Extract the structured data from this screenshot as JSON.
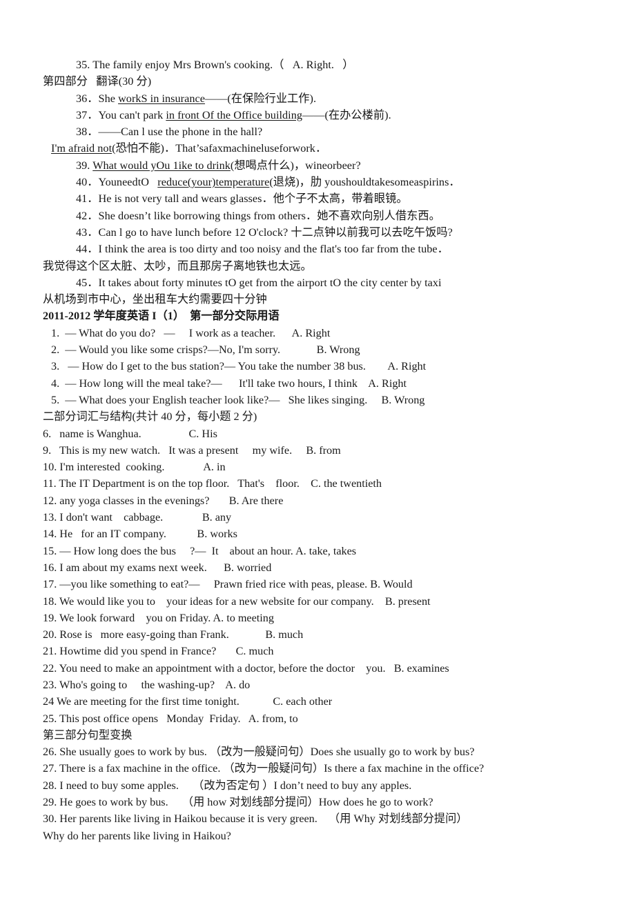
{
  "document": {
    "type": "scanned-exam-paper",
    "page_background": "#ffffff",
    "text_color": "#161616"
  },
  "part_four": {
    "q35": "35. The family enjoy Mrs Brown's cooking.（   A. Right.   ）",
    "heading": "第四部分   翻译(30 分)",
    "q36_pre": "36．She ",
    "q36_underline": "workS in insurance",
    "q36_post": "——(在保险行业工作).",
    "q37_pre": "37．You can't park ",
    "q37_underline": "in front Of the Office building",
    "q37_post": "——(在办公楼前).",
    "q38": "38．——Can l use the phone in the hall?",
    "q38b_underline": "I'm afraid not",
    "q38b_post": "(恐怕不能)．That’safaxmachineluseforwork．",
    "q39_pre": "39. ",
    "q39_underline": "What would yOu 1ike to drink",
    "q39_post": "(想喝点什么)，wineorbeer?",
    "q40_pre": "40．YouneedtO   ",
    "q40_underline": "reduce(your)temperature",
    "q40_post": "(退烧)，肋 youshouldtakesomeaspirins．",
    "q41": "41．He is not very tall and wears glasses．他个子不太高，带着眼镜。",
    "q42": "42．She doesn’t like borrowing things from others．她不喜欢向别人借东西。",
    "q43": "43．Can l go to have lunch before 12 O'clock? 十二点钟以前我可以去吃午饭吗?",
    "q44": "44．I think the area is too dirty and too noisy and the flat's too far from the tube．",
    "q44_cn": "我觉得这个区太脏、太吵，而且那房子离地铁也太远。",
    "q45": "45．It takes about forty minutes tO get from the airport tO the city center by taxi",
    "q45_cn": "从机场到市中心，坐出租车大约需要四十分钟"
  },
  "part_one": {
    "heading": "2011-2012 学年度英语 I（1）  第一部分交际用语",
    "items": [
      "1.  — What do you do?   —     I work as a teacher.      A. Right",
      "2.  — Would you like some crisps?—No, I'm sorry.             B. Wrong",
      "3.   — How do I get to the bus station?— You take the number 38 bus.        A. Right",
      "4.  — How long will the meal take?—      It'll take two hours, I think    A. Right",
      "5.  — What does your English teacher look like?—   She likes singing.     B. Wrong"
    ]
  },
  "part_two": {
    "heading": "二部分词汇与结构(共计 40 分，每小题 2 分)",
    "items": [
      "6.   name is Wanghua.                 C. His",
      "9.   This is my new watch.   It was a present     my wife.     B. from",
      "10. I'm interested  cooking.              A. in",
      "11. The IT Department is on the top floor.   That's    floor.    C. the twentieth",
      "12. any yoga classes in the evenings?       B. Are there",
      "13. I don't want    cabbage.              B. any",
      "14. He   for an IT company.           B. works",
      "15. — How long does the bus     ?—  It    about an hour. A. take, takes",
      "16. I am about my exams next week.      B. worried",
      "17. —you like something to eat?—     Prawn fried rice with peas, please. B. Would",
      "18. We would like you to    your ideas for a new website for our company.    B. present",
      "19. We look forward    you on Friday. A. to meeting",
      "20. Rose is   more easy-going than Frank.             B. much",
      "21. Howtime did you spend in France?       C. much",
      "22. You need to make an appointment with a doctor, before the doctor    you.   B. examines",
      "23. Who's going to     the washing-up?    A. do",
      "24 We are meeting for the first time tonight.            C. each other",
      "25. This post office opens   Monday  Friday.   A. from, to"
    ]
  },
  "part_three": {
    "heading": "第三部分句型变换",
    "items": [
      "26. She usually goes to work by bus. （改为一般疑问句）Does she usually go to work by bus?",
      "27. There is a fax machine in the office. （改为一般疑问句）Is there a fax machine in the office?",
      "28. I need to buy some apples.     （改为否定句 ）I don’t need to buy any apples.",
      "29. He goes to work by bus.     （用 how 对划线部分提问）How does he go to work?",
      "30. Her parents like living in Haikou because it is very green.    （用 Why 对划线部分提问）",
      "Why do her parents like living in Haikou?"
    ]
  }
}
